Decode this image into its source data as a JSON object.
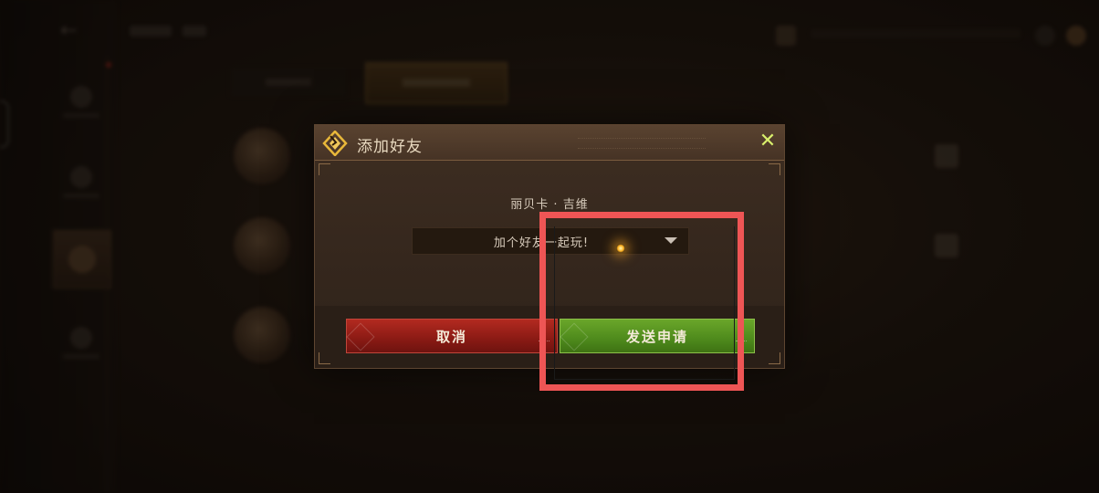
{
  "dialog": {
    "title": "添加好友",
    "player_name": "丽贝卡 · 吉维",
    "message_select": {
      "selected": "加个好友一起玩!"
    },
    "buttons": {
      "cancel": "取消",
      "send": "发送申请"
    }
  },
  "colors": {
    "cancel_red": "#b22a20",
    "send_green": "#5c9a22",
    "close_icon": "#d9ef6c",
    "highlight": "#ee5555"
  },
  "icons": {
    "close": "close-icon",
    "emblem": "diamond-emblem-icon",
    "dropdown": "chevron-down-icon",
    "back": "back-arrow-icon"
  }
}
